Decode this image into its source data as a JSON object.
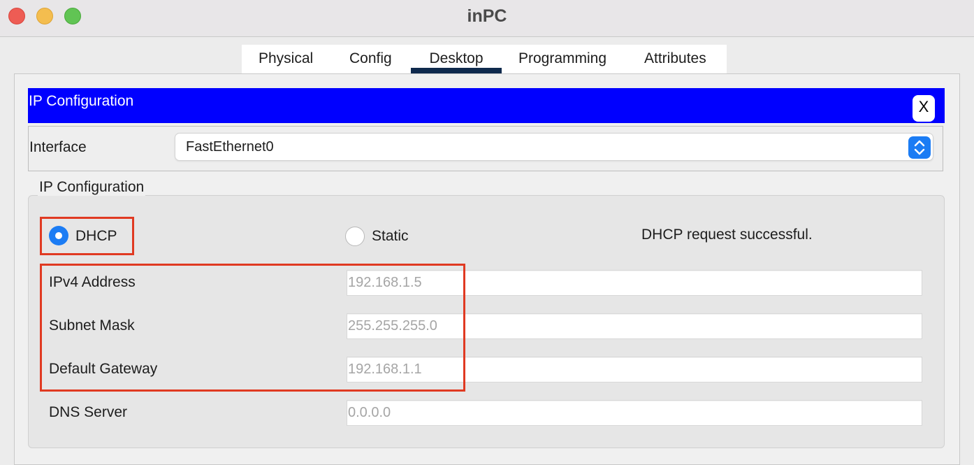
{
  "window": {
    "title": "inPC"
  },
  "tabs": [
    {
      "label": "Physical"
    },
    {
      "label": "Config"
    },
    {
      "label": "Desktop",
      "active": true
    },
    {
      "label": "Programming"
    },
    {
      "label": "Attributes"
    }
  ],
  "app": {
    "title": "IP Configuration",
    "close_label": "X"
  },
  "interface": {
    "label": "Interface",
    "selected": "FastEthernet0"
  },
  "ip_config": {
    "group_title": "IP Configuration",
    "mode_options": [
      {
        "label": "DHCP",
        "selected": true
      },
      {
        "label": "Static",
        "selected": false
      }
    ],
    "status": "DHCP request successful.",
    "fields": [
      {
        "label": "IPv4 Address",
        "value": "192.168.1.5"
      },
      {
        "label": "Subnet Mask",
        "value": "255.255.255.0"
      },
      {
        "label": "Default Gateway",
        "value": "192.168.1.1"
      },
      {
        "label": "DNS Server",
        "value": "0.0.0.0"
      }
    ]
  },
  "colors": {
    "banner": "#0000ff",
    "highlight": "#e03a22",
    "accent": "#1b7cf4",
    "active_tab_underline": "#0f2a4d"
  },
  "icons": {
    "window_controls": [
      "close-dot-icon",
      "minimize-dot-icon",
      "zoom-dot-icon"
    ],
    "select": "updown-chevron-icon"
  }
}
